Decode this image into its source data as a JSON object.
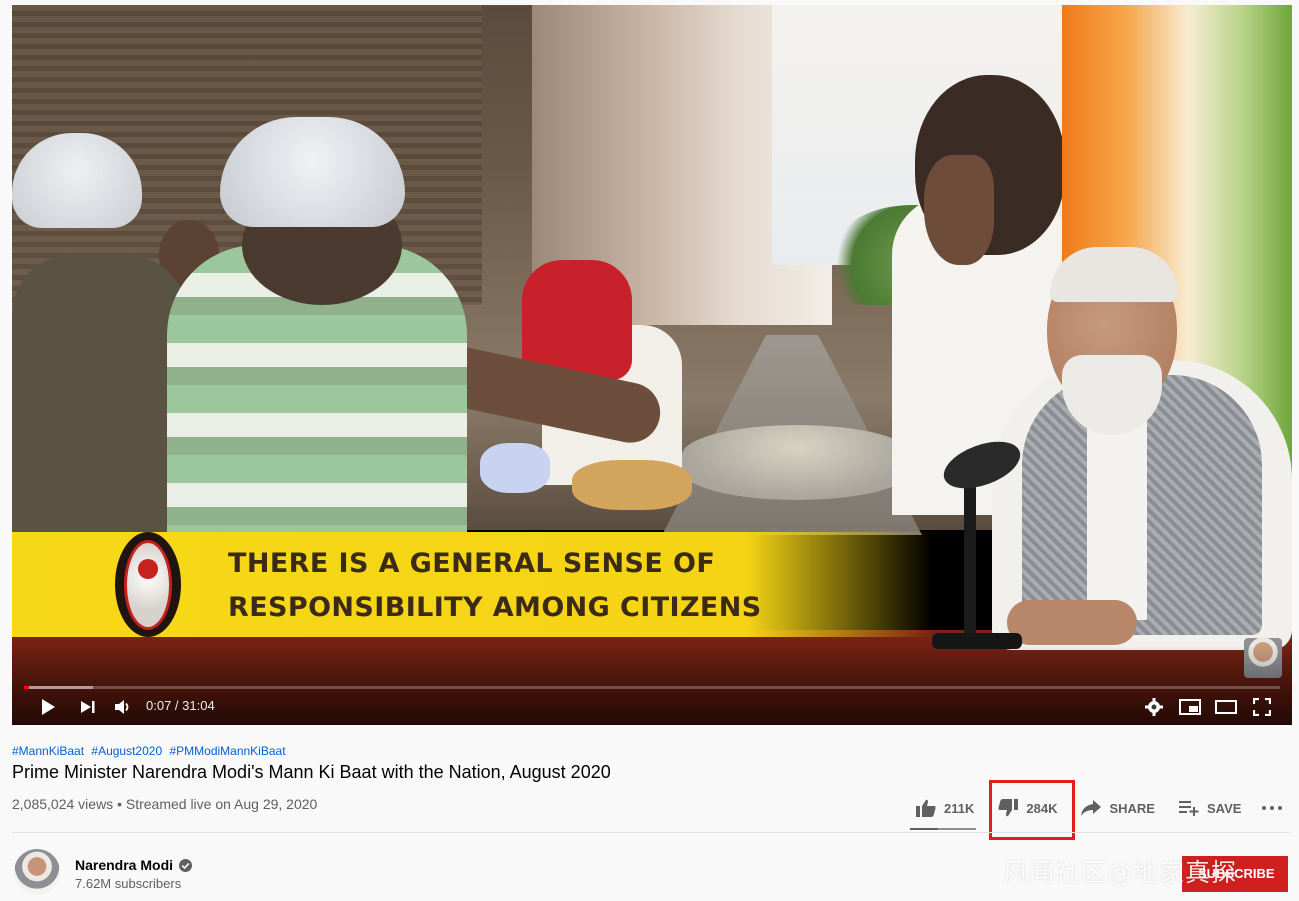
{
  "video": {
    "banner_line1": "THERE IS A GENERAL SENSE OF",
    "banner_line2": "RESPONSIBILITY AMONG CITIZENS",
    "time": "0:07 / 31:04",
    "progress_played_fraction": 0.004,
    "progress_loaded_fraction": 0.055
  },
  "hashtags": [
    "#MannKiBaat",
    "#August2020",
    "#PMModiMannKiBaat"
  ],
  "title": "Prime Minister Narendra Modi's Mann Ki Baat with the Nation, August 2020",
  "info": "2,085,024 views • Streamed live on Aug 29, 2020",
  "actions": {
    "like_count": "211K",
    "dislike_count": "284K",
    "share_label": "SHARE",
    "save_label": "SAVE"
  },
  "like_ratio_fraction": 0.43,
  "channel": {
    "name": "Narendra Modi",
    "subscribers": "7.62M subscribers"
  },
  "subscribe_label": "SUBSCRIBE",
  "watermark": "风闻社区@地家真探",
  "colors": {
    "accent_red": "#ff0000",
    "highlight_box": "#e0201c",
    "hashtag_blue": "#065fd4",
    "banner_yellow": "#f6d916"
  }
}
